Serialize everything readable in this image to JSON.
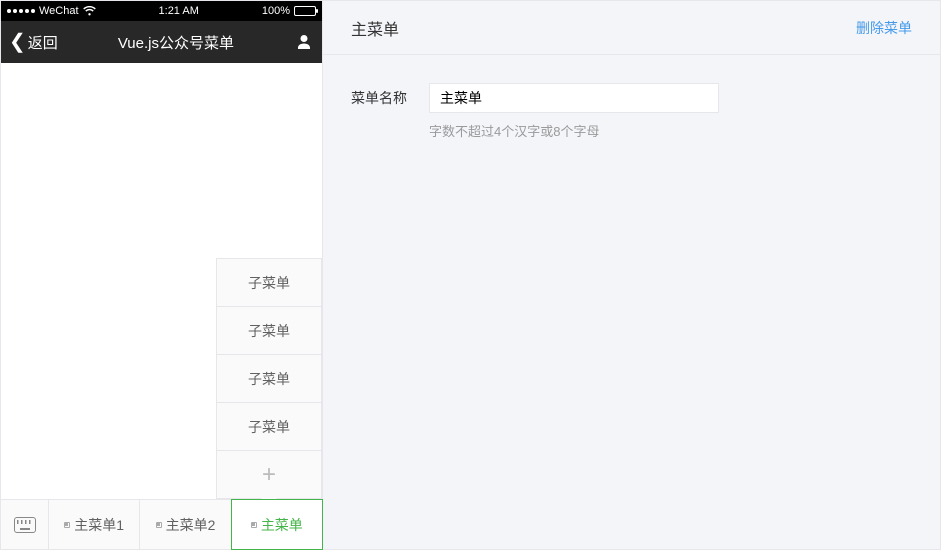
{
  "statusbar": {
    "carrier": "WeChat",
    "time": "1:21 AM",
    "battery_pct": "100%"
  },
  "navbar": {
    "back_label": "返回",
    "title": "Vue.js公众号菜单"
  },
  "submenus": [
    {
      "label": "子菜单"
    },
    {
      "label": "子菜单"
    },
    {
      "label": "子菜单"
    },
    {
      "label": "子菜单"
    }
  ],
  "add_label": "+",
  "bottom_menus": [
    {
      "label": "主菜单1",
      "active": false
    },
    {
      "label": "主菜单2",
      "active": false
    },
    {
      "label": "主菜单",
      "active": true
    }
  ],
  "editor": {
    "header_title": "主菜单",
    "delete_label": "删除菜单",
    "name_label": "菜单名称",
    "name_value": "主菜单",
    "name_hint": "字数不超过4个汉字或8个字母"
  }
}
